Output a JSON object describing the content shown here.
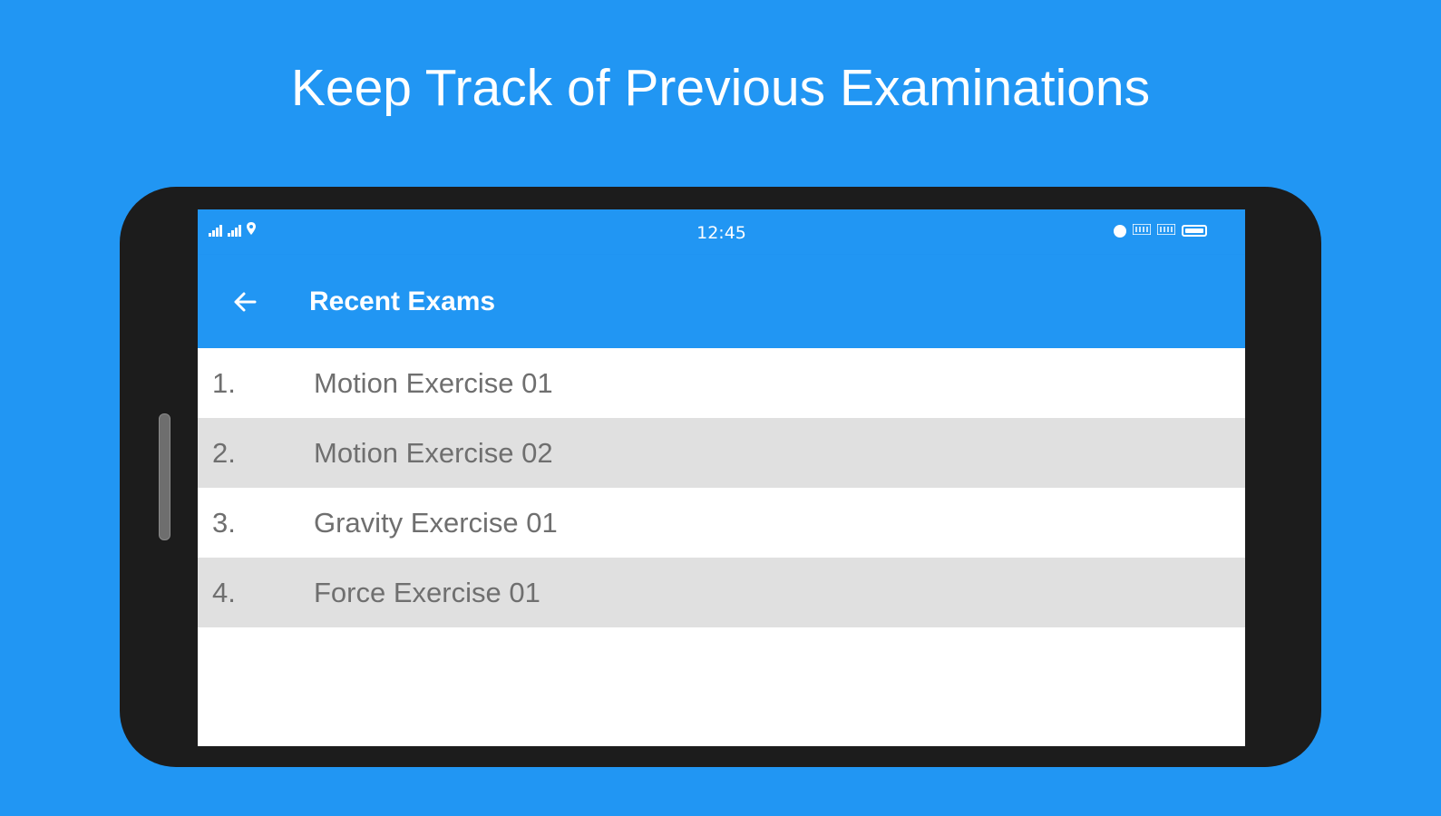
{
  "headline": "Keep Track of Previous Examinations",
  "status_bar": {
    "time": "12:45",
    "left_icons": [
      "signal-icon",
      "signal-icon",
      "location-icon"
    ],
    "right_icons": [
      "alarm-icon",
      "network-speed-icon",
      "network-speed-icon",
      "battery-icon"
    ]
  },
  "appbar": {
    "title": "Recent Exams",
    "back_icon": "arrow-left-icon"
  },
  "exams": [
    {
      "number": "1.",
      "name": "Motion Exercise 01"
    },
    {
      "number": "2.",
      "name": "Motion Exercise 02"
    },
    {
      "number": "3.",
      "name": "Gravity Exercise 01"
    },
    {
      "number": "4.",
      "name": "Force Exercise 01"
    }
  ],
  "colors": {
    "background": "#2196F3",
    "appbar": "#2196F3",
    "device_frame": "#1c1c1c",
    "row_alt": "#e0e0e0",
    "row_text": "#6f6f6f"
  }
}
